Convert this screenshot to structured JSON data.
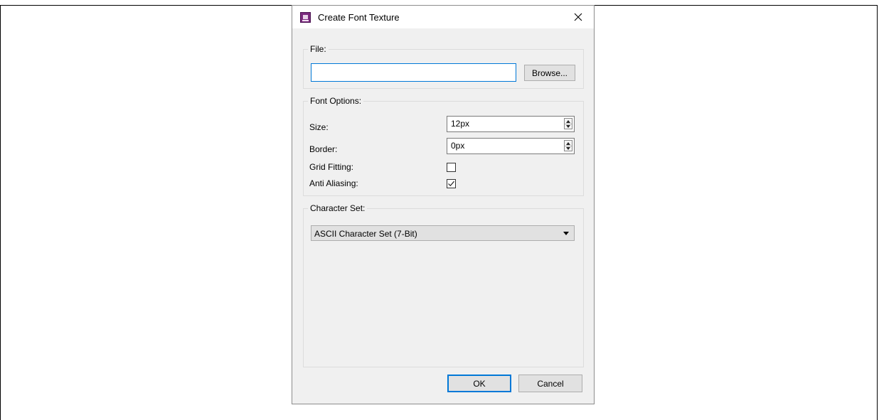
{
  "dialog": {
    "title": "Create Font Texture",
    "close_icon": "close-icon",
    "app_icon": "app-icon"
  },
  "file_group": {
    "label": "File:",
    "path_value": "",
    "browse_label": "Browse..."
  },
  "font_options": {
    "label": "Font Options:",
    "size_label": "Size:",
    "size_value": "12px",
    "border_label": "Border:",
    "border_value": "0px",
    "grid_fitting_label": "Grid Fitting:",
    "grid_fitting_checked": false,
    "anti_aliasing_label": "Anti Aliasing:",
    "anti_aliasing_checked": true
  },
  "character_set": {
    "label": "Character Set:",
    "selected": "ASCII Character Set (7-Bit)"
  },
  "footer": {
    "ok_label": "OK",
    "cancel_label": "Cancel"
  },
  "colors": {
    "dialog_bg": "#f0f0f0",
    "focus_accent": "#0078d7",
    "app_icon_color": "#7a2a7e"
  }
}
